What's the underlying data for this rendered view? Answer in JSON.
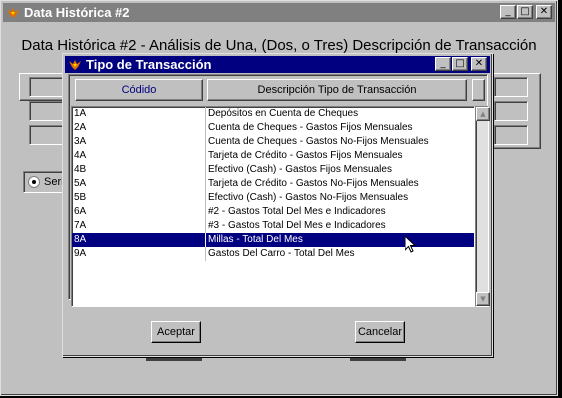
{
  "main_window": {
    "title": "Data Histórica #2",
    "heading": "Data Histórica #2 - Análisis de Una, (Dos, o Tres) Descripción de Transacción",
    "radio_label": "Serie"
  },
  "title_buttons": {
    "minimize": "_",
    "maximize": "□",
    "close": "✕"
  },
  "dialog": {
    "title": "Tipo de Transacción",
    "columns": [
      "Códido",
      "Descripción Tipo de Transacción"
    ],
    "rows": [
      {
        "code": "1A",
        "desc": "Depósitos en Cuenta de Cheques"
      },
      {
        "code": "2A",
        "desc": "Cuenta de Cheques - Gastos Fijos Mensuales"
      },
      {
        "code": "3A",
        "desc": "Cuenta de Cheques - Gastos No-Fijos Mensuales"
      },
      {
        "code": "4A",
        "desc": "Tarjeta de Crédito - Gastos Fijos Mensuales"
      },
      {
        "code": "4B",
        "desc": "Efectivo (Cash) - Gastos Fijos Mensuales"
      },
      {
        "code": "5A",
        "desc": "Tarjeta de Crédito - Gastos No-Fijos Mensuales"
      },
      {
        "code": "5B",
        "desc": "Efectivo (Cash) - Gastos No-Fijos Mensuales"
      },
      {
        "code": "6A",
        "desc": "#2 - Gastos Total Del Mes e Indicadores"
      },
      {
        "code": "7A",
        "desc": "#3 - Gastos Total Del Mes e Indicadores"
      },
      {
        "code": "8A",
        "desc": "Millas - Total Del Mes"
      },
      {
        "code": "9A",
        "desc": "Gastos Del Carro - Total Del Mes"
      }
    ],
    "selected_code": "8A",
    "accept_label": "Aceptar",
    "cancel_label": "Cancelar"
  },
  "colors": {
    "active_title": "#000080",
    "inactive_title": "#808080",
    "face": "#c0c0c0",
    "selection": "#000080"
  },
  "icons": {
    "app": "bird-logo-icon",
    "scroll_up": "triangle-up",
    "scroll_down": "triangle-down",
    "pointer": "arrow-cursor"
  }
}
